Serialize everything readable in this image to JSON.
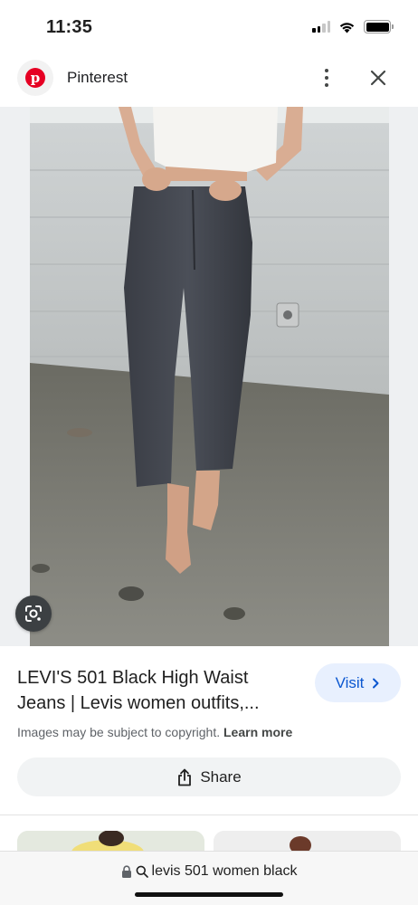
{
  "status_bar": {
    "time": "11:35"
  },
  "header": {
    "site_name": "Pinterest",
    "logo_icon": "pinterest-logo",
    "more_icon": "more-vertical-icon",
    "close_icon": "close-icon"
  },
  "image": {
    "lens_icon": "google-lens-icon"
  },
  "result": {
    "title_line1": "LEVI'S 501 Black High Waist",
    "title_line2": "Jeans | Levis women outfits,...",
    "visit_label": "Visit",
    "copyright_text": "Images may be subject to copyright.",
    "learn_more_label": "Learn more",
    "share_label": "Share"
  },
  "browser": {
    "address_text": "levis 501 women black"
  },
  "colors": {
    "pinterest_red": "#e60023",
    "visit_bg": "#e8f0fe",
    "visit_text": "#0b57d0"
  }
}
